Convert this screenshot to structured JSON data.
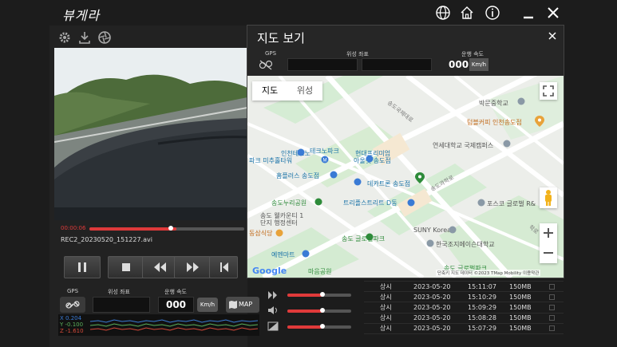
{
  "app": {
    "logo_text": "뷰게라"
  },
  "video": {
    "current_time": "00:00:06",
    "filename": "REC2_20230520_151227.avi",
    "progress": 0.56
  },
  "bottom_info": {
    "gps_label": "GPS",
    "coord_label": "위성 좌표",
    "speed_label": "운행 속도",
    "speed_value": "000",
    "speed_unit": "Km/h",
    "map_button": "MAP",
    "accel": {
      "x": "X  0.204",
      "y": "Y  -0.100",
      "z": "Z  -1.610"
    }
  },
  "map_window": {
    "title": "지도 보기",
    "gps_label": "GPS",
    "coord_label": "위성 좌표",
    "speed_label": "운행 속도",
    "speed_value": "000",
    "speed_unit": "Km/h",
    "tabs": [
      "지도",
      "위성"
    ],
    "labels": {
      "l1": "인천테크노",
      "l2": "파크 미추홀타워",
      "l3": "테크노파크",
      "l4": "현대프리미엄",
      "l5": "아울렛 송도점",
      "l6": "홈플러스 송도점",
      "l7": "데카트론 송도점",
      "l8": "송도누리공원",
      "l9": "트리플스트리트 D동",
      "l10": "송도 웰카운티 1",
      "l11": "단지 행정센터",
      "l12": "예멘마트",
      "l13": "송도 글로벌파크",
      "l14": "마음공원",
      "l15": "박문중학교",
      "l16": "텀블커피 인천송도점",
      "l17": "연세대학교 국제캠퍼스",
      "l18": "포스코 글로벌 R&",
      "l19": "SUNY Korea",
      "l20": "한국조지메이슨대학교",
      "l21": "송도과학로",
      "l22": "송도국제대로",
      "l23": "동삼식당",
      "l24": "송도 글로벌파크",
      "l25": "학로"
    },
    "google": "Google",
    "attribution": "단축키  지도 데이터 ©2023 TMap Mobility  이용약관"
  },
  "records": [
    {
      "type": "상시",
      "date": "2023-05-20",
      "time": "15:11:07",
      "size": "150MB"
    },
    {
      "type": "상시",
      "date": "2023-05-20",
      "time": "15:10:29",
      "size": "150MB"
    },
    {
      "type": "상시",
      "date": "2023-05-20",
      "time": "15:09:29",
      "size": "150MB"
    },
    {
      "type": "상시",
      "date": "2023-05-20",
      "time": "15:08:28",
      "size": "150MB"
    },
    {
      "type": "상시",
      "date": "2023-05-20",
      "time": "15:07:29",
      "size": "150MB"
    }
  ],
  "sliders": [
    {
      "level": 0.55
    },
    {
      "level": 0.55
    },
    {
      "level": 0.55
    }
  ],
  "colors": {
    "accent": "#e03a3a",
    "orange": "#e8a23a"
  }
}
